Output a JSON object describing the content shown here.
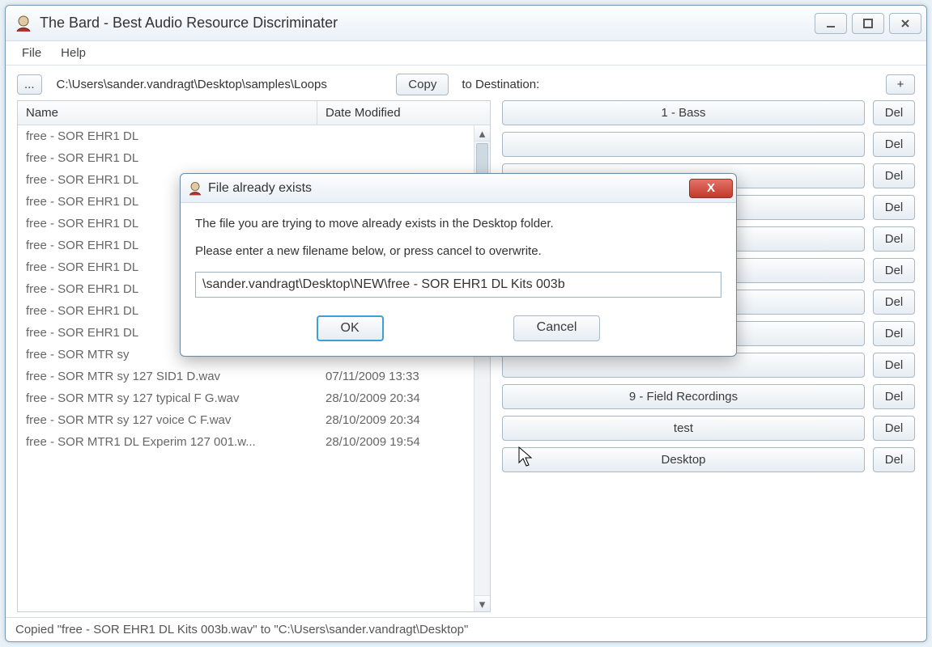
{
  "window": {
    "title": "The Bard - Best Audio Resource Discriminater"
  },
  "menubar": {
    "file": "File",
    "help": "Help"
  },
  "toolbar": {
    "browse": "...",
    "path": "C:\\Users\\sander.vandragt\\Desktop\\samples\\Loops",
    "copy": "Copy",
    "to_dest": "to  Destination:",
    "add": "+"
  },
  "list": {
    "col_name": "Name",
    "col_date": "Date Modified",
    "rows": [
      {
        "name": "free - SOR EHR1 DL",
        "date": ""
      },
      {
        "name": "free - SOR EHR1 DL",
        "date": ""
      },
      {
        "name": "free - SOR EHR1 DL",
        "date": ""
      },
      {
        "name": "free - SOR EHR1 DL",
        "date": ""
      },
      {
        "name": "free - SOR EHR1 DL",
        "date": ""
      },
      {
        "name": "free - SOR EHR1 DL",
        "date": ""
      },
      {
        "name": "free - SOR EHR1 DL",
        "date": ""
      },
      {
        "name": "free - SOR EHR1 DL",
        "date": ""
      },
      {
        "name": "free - SOR EHR1 DL",
        "date": ""
      },
      {
        "name": "free - SOR EHR1 DL",
        "date": ""
      },
      {
        "name": "free - SOR MTR sy",
        "date": ""
      },
      {
        "name": "free - SOR MTR sy 127 SID1 D.wav",
        "date": "07/11/2009 13:33"
      },
      {
        "name": "free - SOR MTR sy 127 typical F G.wav",
        "date": "28/10/2009 20:34"
      },
      {
        "name": "free - SOR MTR sy 127 voice C F.wav",
        "date": "28/10/2009 20:34"
      },
      {
        "name": "free - SOR MTR1 DL Experim 127 001.w...",
        "date": "28/10/2009 19:54"
      }
    ]
  },
  "destinations": {
    "del": "Del",
    "items": [
      "1 - Bass",
      "",
      "",
      "",
      "",
      "",
      "",
      "",
      "",
      "9 - Field Recordings",
      "test",
      "Desktop"
    ]
  },
  "statusbar": "Copied \"free - SOR EHR1 DL Kits 003b.wav\" to \"C:\\Users\\sander.vandragt\\Desktop\"",
  "dialog": {
    "title": "File already exists",
    "line1": "The file you are trying to move already exists in the Desktop folder.",
    "line2": "Please enter a new filename below, or press cancel to overwrite.",
    "input_value": "\\sander.vandragt\\Desktop\\NEW\\free - SOR EHR1 DL Kits 003b",
    "ok": "OK",
    "cancel": "Cancel",
    "close_x": "X"
  }
}
